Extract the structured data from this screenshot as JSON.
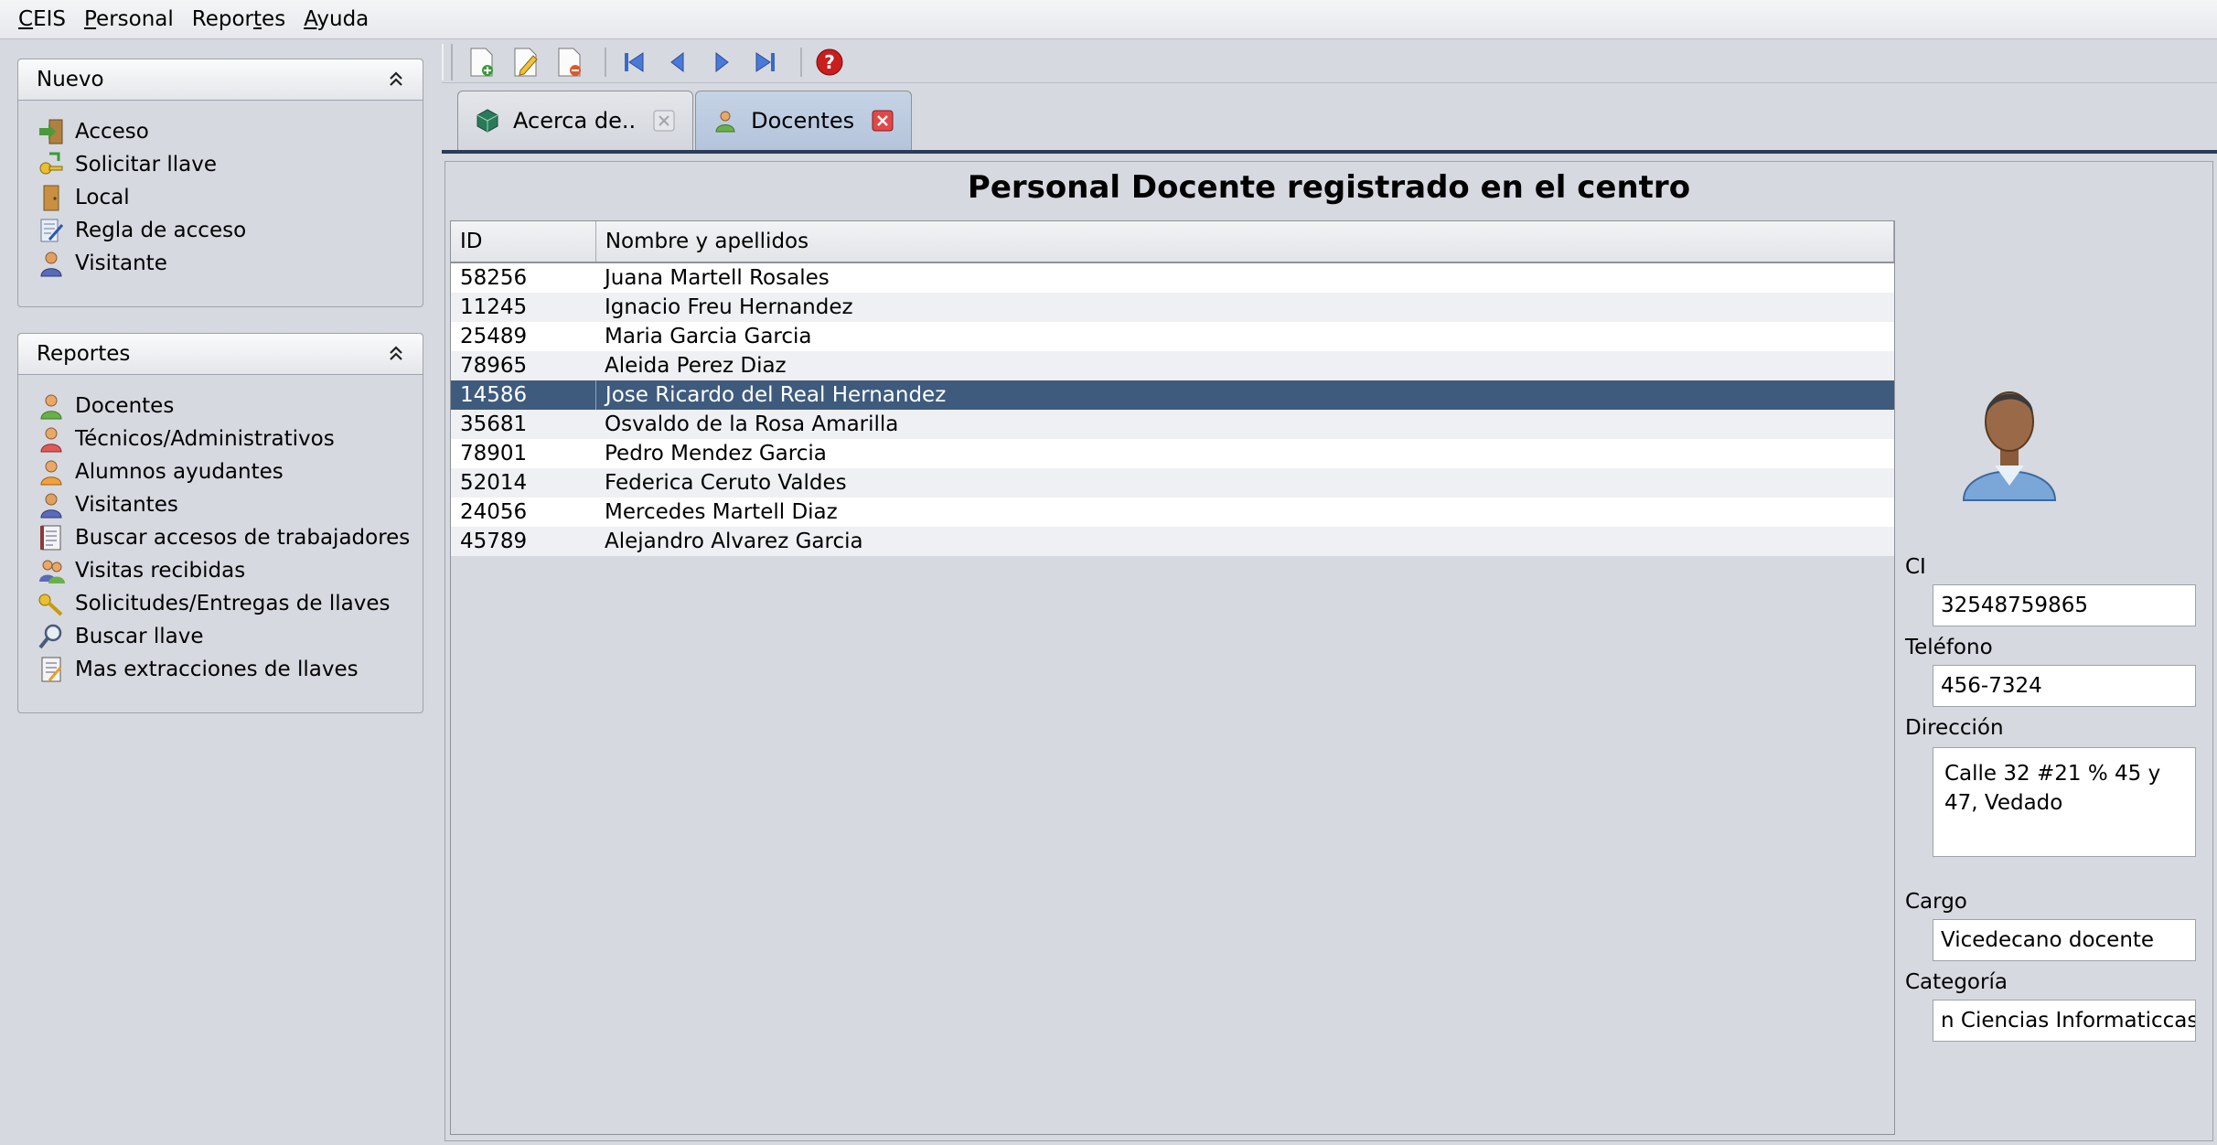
{
  "menu": {
    "items": [
      {
        "mnemonic": "C",
        "rest": "EIS"
      },
      {
        "mnemonic": "P",
        "rest": "ersonal"
      },
      {
        "pre": "Repor",
        "mnemonic": "t",
        "rest": "es"
      },
      {
        "mnemonic": "A",
        "rest": "yuda"
      }
    ]
  },
  "nuevo": {
    "title": "Nuevo",
    "items": [
      "Acceso",
      "Solicitar llave",
      "Local",
      "Regla de acceso",
      "Visitante"
    ]
  },
  "reportes": {
    "title": "Reportes",
    "items": [
      "Docentes",
      "Técnicos/Administrativos",
      "Alumnos ayudantes",
      "Visitantes",
      "Buscar accesos de trabajadores",
      "Visitas recibidas",
      "Solicitudes/Entregas de llaves",
      "Buscar llave",
      "Mas extracciones de llaves"
    ]
  },
  "tabs": [
    {
      "label": "Acerca de.."
    },
    {
      "label": "Docentes"
    }
  ],
  "content": {
    "title": "Personal Docente registrado en el centro",
    "columns": [
      "ID",
      "Nombre y apellidos"
    ],
    "rows": [
      [
        "58256",
        "Juana Martell Rosales"
      ],
      [
        "11245",
        "Ignacio Freu Hernandez"
      ],
      [
        "25489",
        "Maria Garcia Garcia"
      ],
      [
        "78965",
        "Aleida Perez Diaz"
      ],
      [
        "14586",
        "Jose Ricardo del Real Hernandez"
      ],
      [
        "35681",
        "Osvaldo de la Rosa Amarilla"
      ],
      [
        "78901",
        "Pedro Mendez Garcia"
      ],
      [
        "52014",
        "Federica Ceruto Valdes"
      ],
      [
        "24056",
        "Mercedes Martell Diaz"
      ],
      [
        "45789",
        "Alejandro Alvarez Garcia"
      ]
    ]
  },
  "detail": {
    "ci_label": "CI",
    "ci_value": "32548759865",
    "telefono_label": "Teléfono",
    "telefono_value": "456-7324",
    "direccion_label": "Dirección",
    "direccion_value": "Calle 32 #21 % 45 y 47, Vedado",
    "cargo_label": "Cargo",
    "cargo_value": "Vicedecano docente",
    "categoria_label": "Categoría",
    "categoria_value": "n Ciencias Informaticcas"
  },
  "colors": {
    "selection": "#3e5b7e",
    "background": "#d6d9df",
    "active_tab": "#b4c4db"
  }
}
